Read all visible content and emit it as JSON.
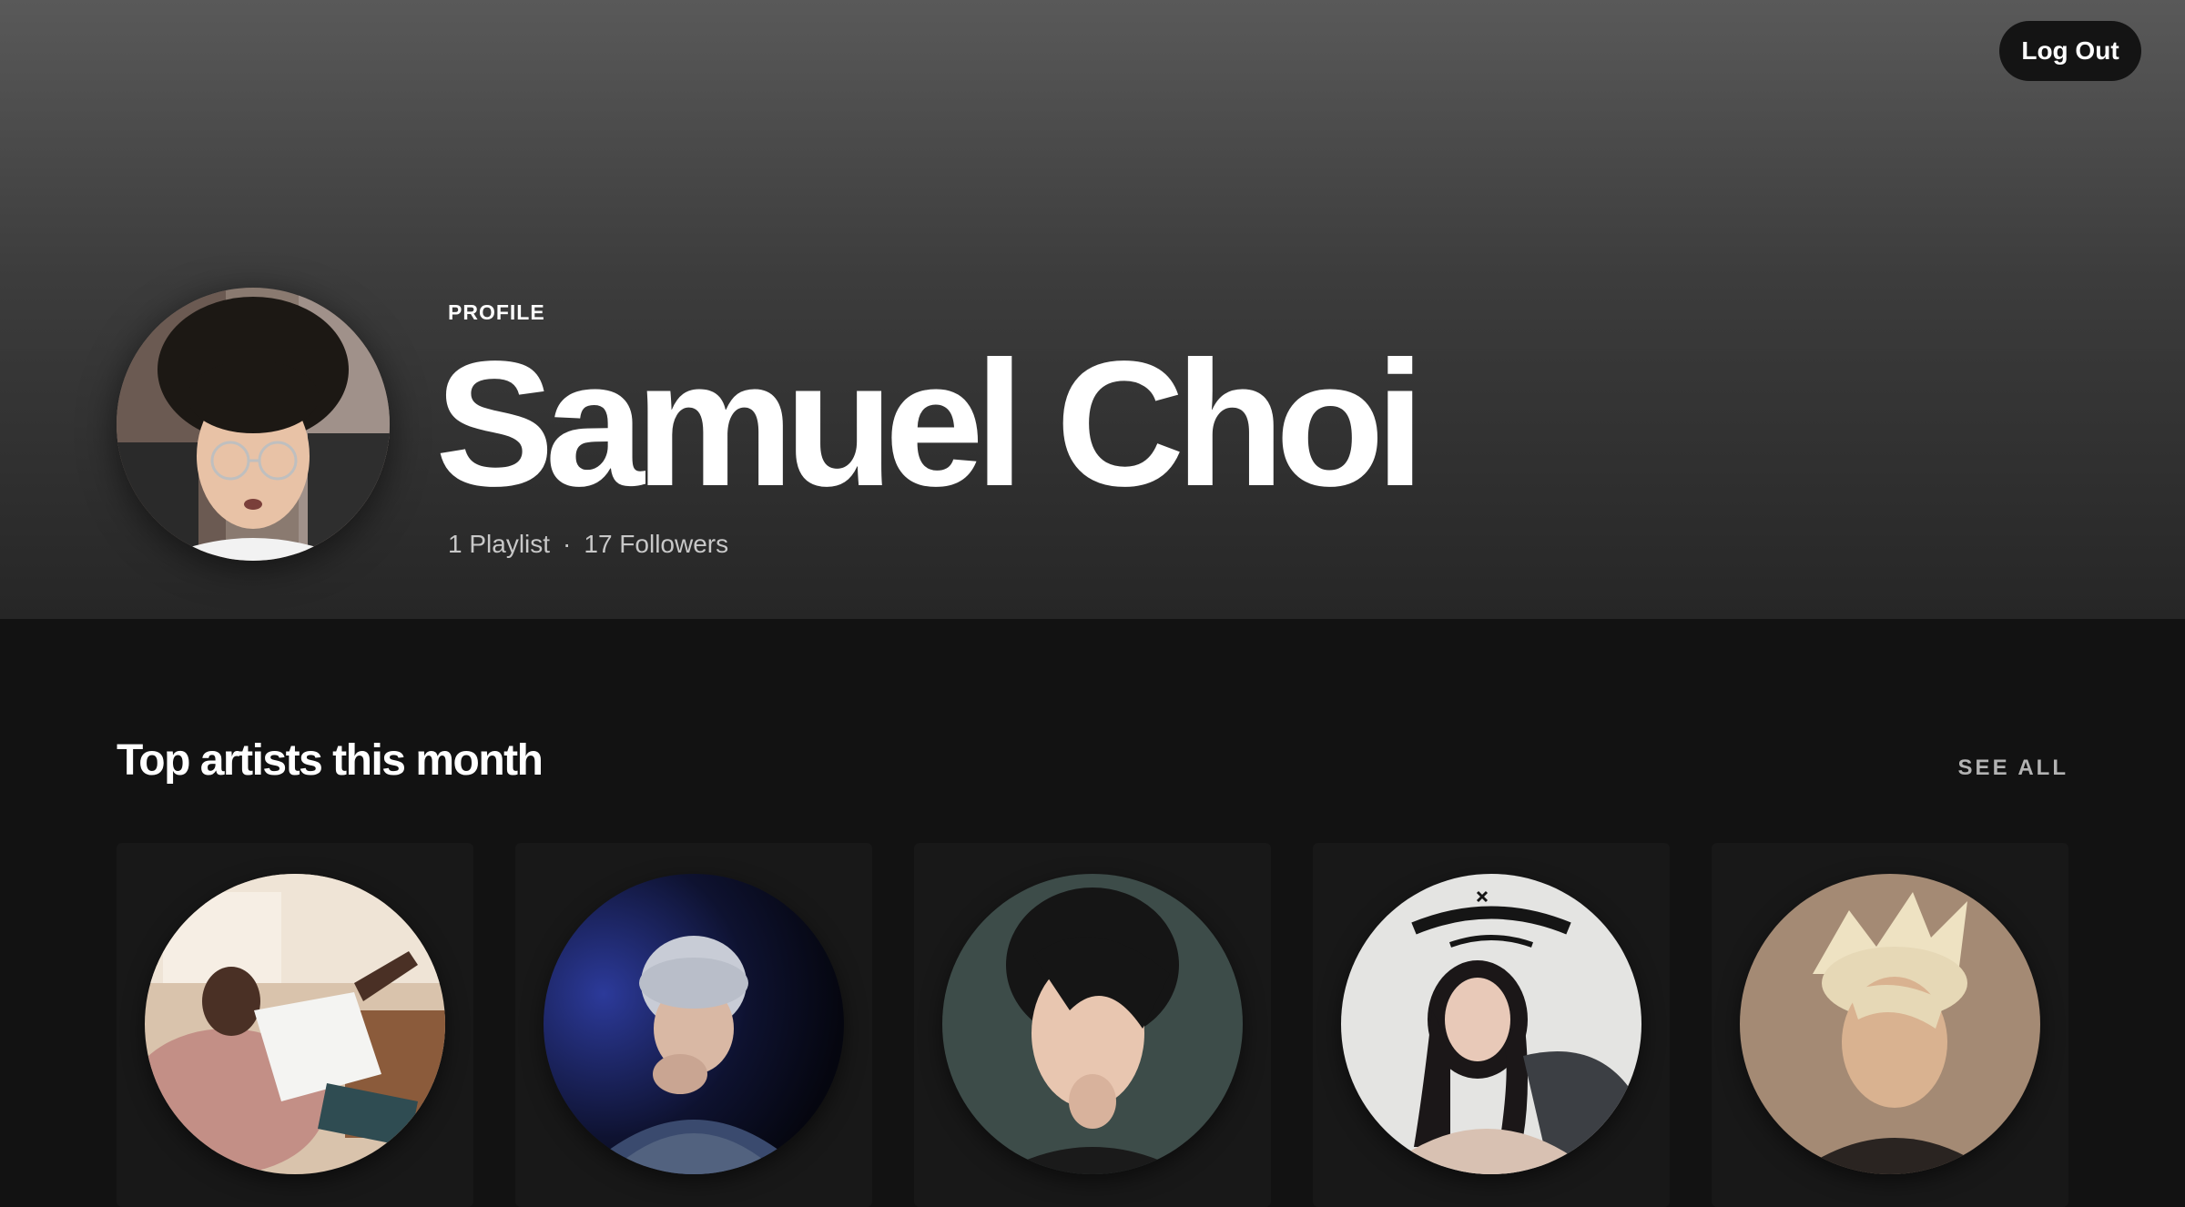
{
  "header": {
    "logout_label": "Log Out",
    "profile_type": "PROFILE",
    "name": "Samuel Choi",
    "playlists": "1 Playlist",
    "separator": "·",
    "followers": "17 Followers"
  },
  "top_artists": {
    "title": "Top artists this month",
    "see_all_label": "SEE ALL",
    "artists": [
      {
        "image": "artist-photo-reclining-man",
        "bg": "#c9a98c"
      },
      {
        "image": "artist-photo-silver-hair-blue",
        "bg": "#1a1f4a"
      },
      {
        "image": "artist-photo-dark-hair-teal",
        "bg": "#2d3b38"
      },
      {
        "image": "artist-photo-lowlife-princess",
        "bg": "#e6e6e6"
      },
      {
        "image": "artist-photo-blond-hair",
        "bg": "#a98f78"
      }
    ]
  },
  "colors": {
    "background": "#121212",
    "header_top": "#595959",
    "card": "#181818",
    "muted_text": "#b3b3b3"
  }
}
